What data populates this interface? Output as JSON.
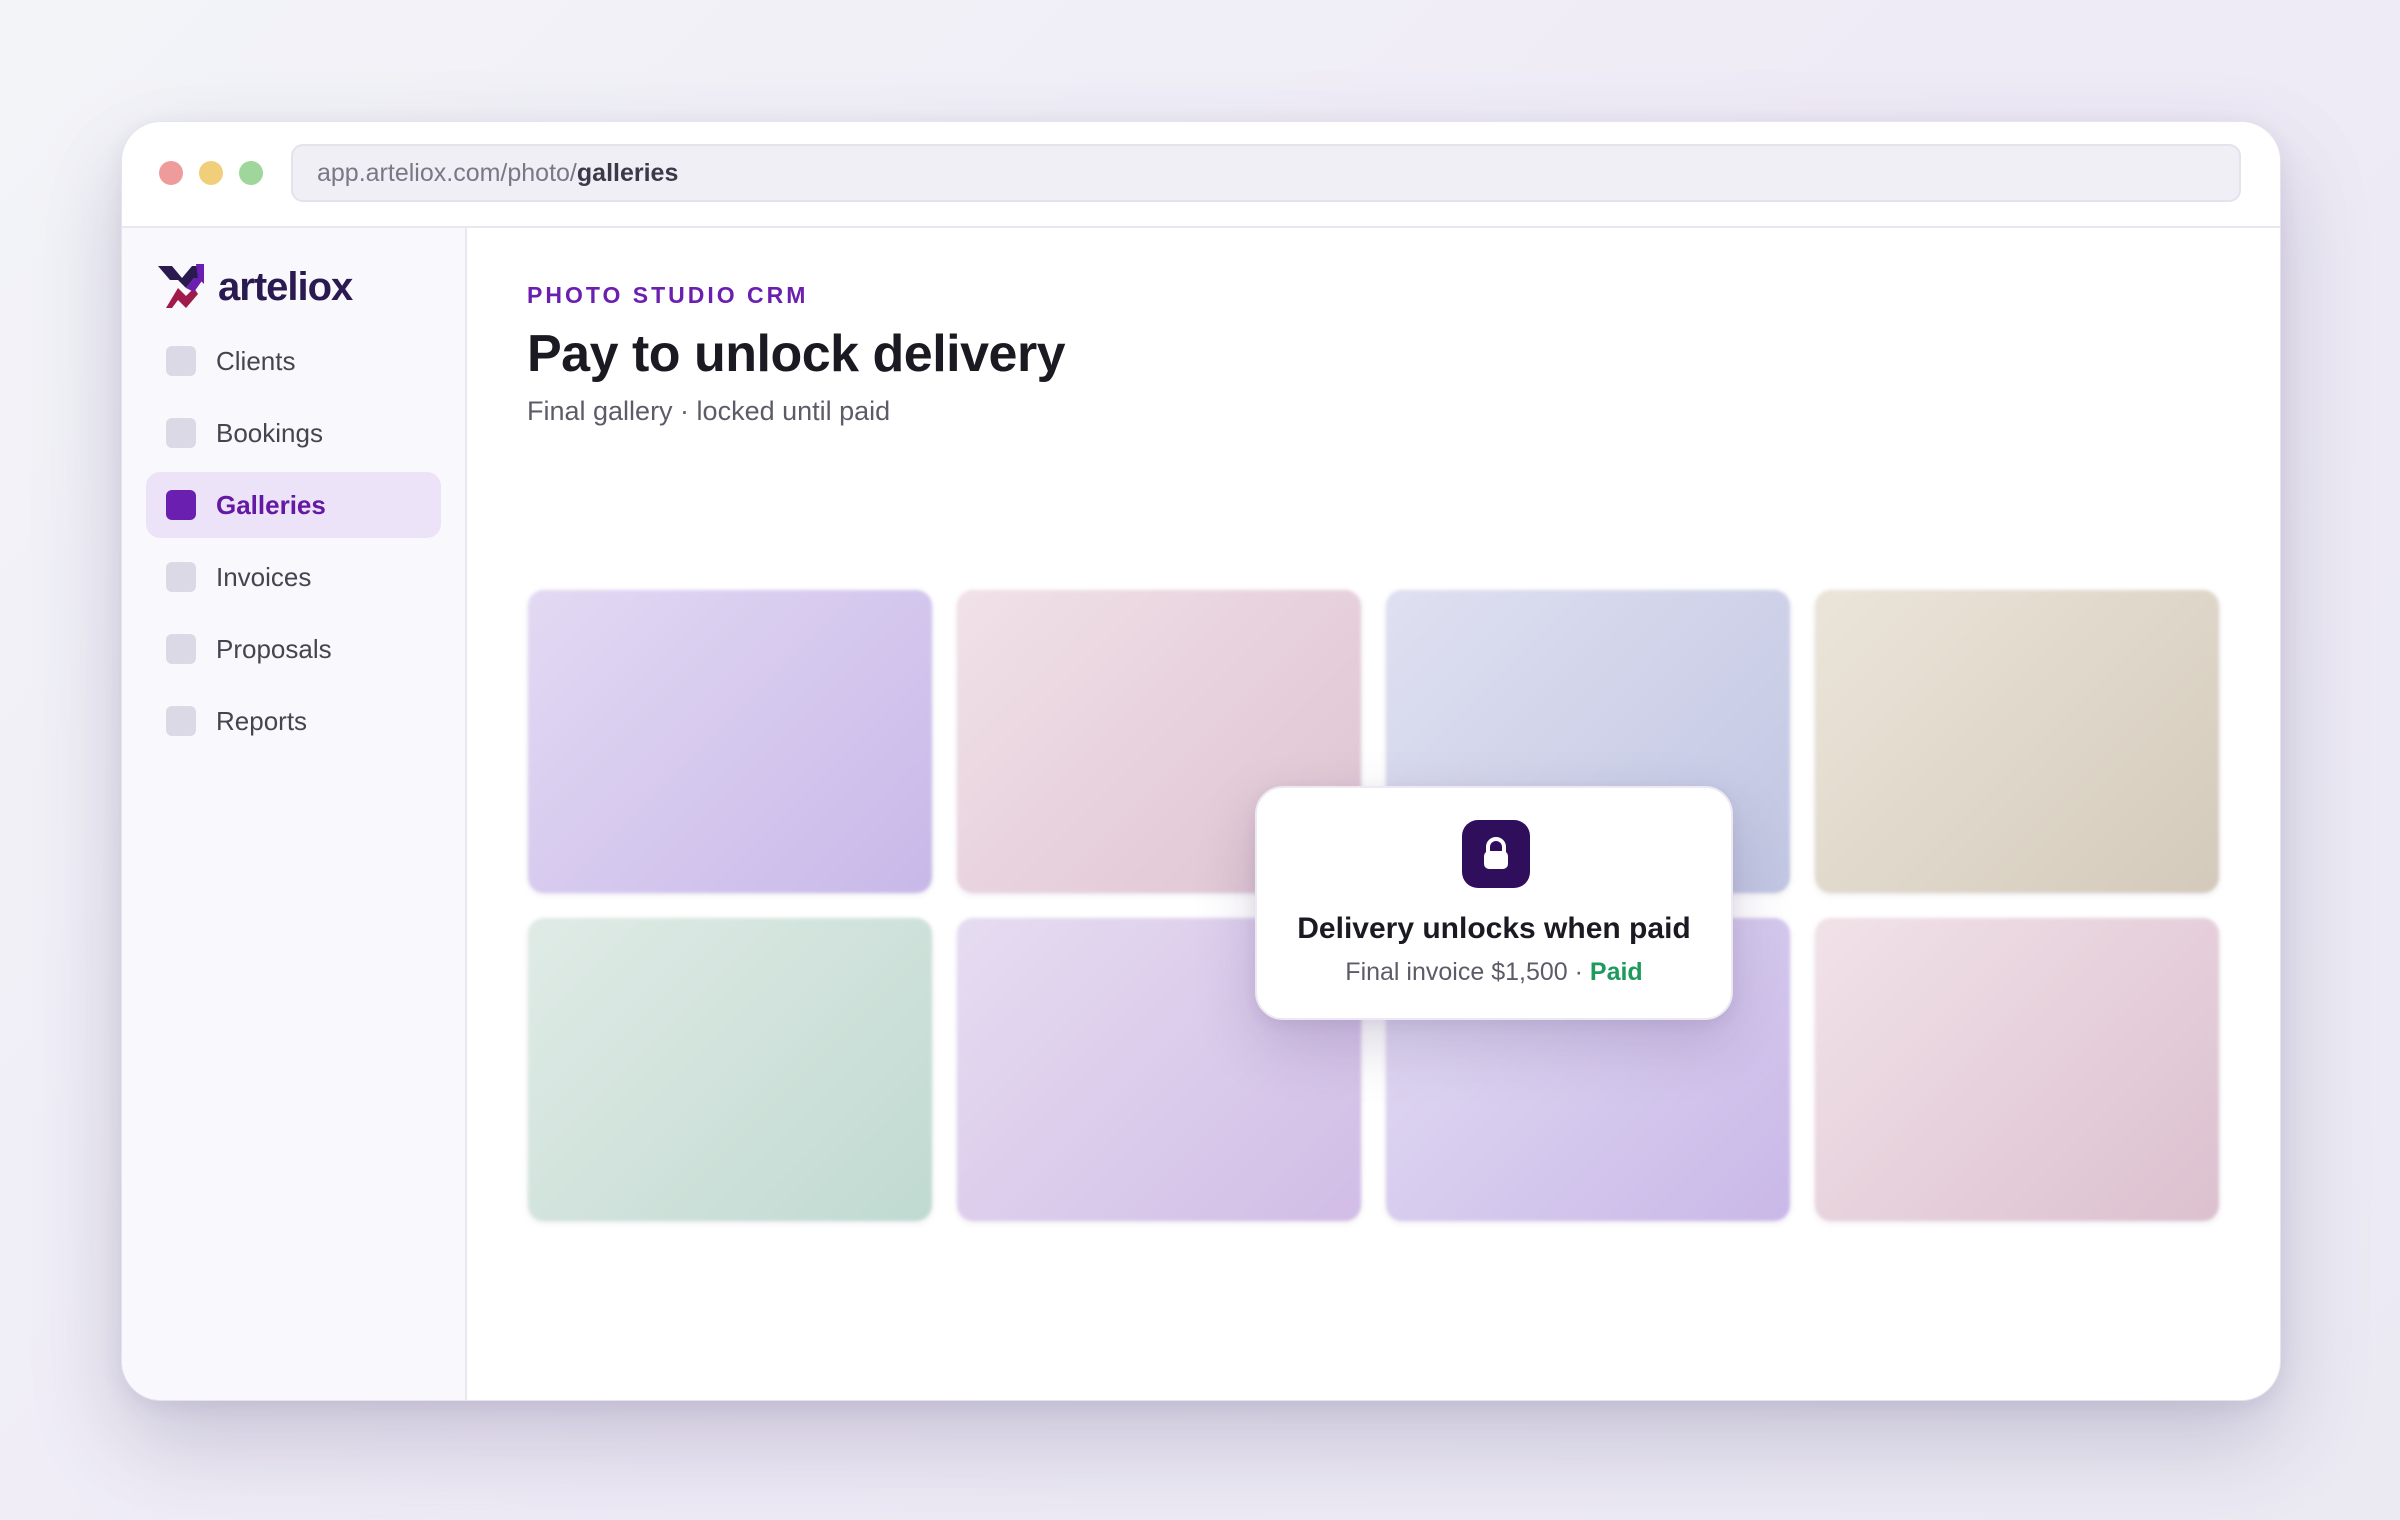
{
  "browser": {
    "url_prefix": "app.arteliox.com/photo/",
    "url_path": "galleries"
  },
  "brand": {
    "name": "arteliox",
    "logo_icon": "arteliox-logo-icon",
    "colors": {
      "accent": "#6b1fb0",
      "dark": "#2f0f5b",
      "paid": "#1e9a5d"
    }
  },
  "sidebar": {
    "items": [
      {
        "label": "Clients",
        "icon": "square-icon",
        "active": false
      },
      {
        "label": "Bookings",
        "icon": "square-icon",
        "active": false
      },
      {
        "label": "Galleries",
        "icon": "square-icon",
        "active": true
      },
      {
        "label": "Invoices",
        "icon": "square-icon",
        "active": false
      },
      {
        "label": "Proposals",
        "icon": "square-icon",
        "active": false
      },
      {
        "label": "Reports",
        "icon": "square-icon",
        "active": false
      }
    ]
  },
  "page": {
    "eyebrow": "PHOTO STUDIO CRM",
    "title": "Pay to unlock delivery",
    "subtitle": "Final gallery · locked until paid"
  },
  "gallery": {
    "thumbnail_count": 8,
    "state": "blurred-locked"
  },
  "lock_card": {
    "icon": "lock-icon",
    "title": "Delivery unlocks when paid",
    "invoice_text": "Final invoice $1,500 · ",
    "status": "Paid"
  }
}
